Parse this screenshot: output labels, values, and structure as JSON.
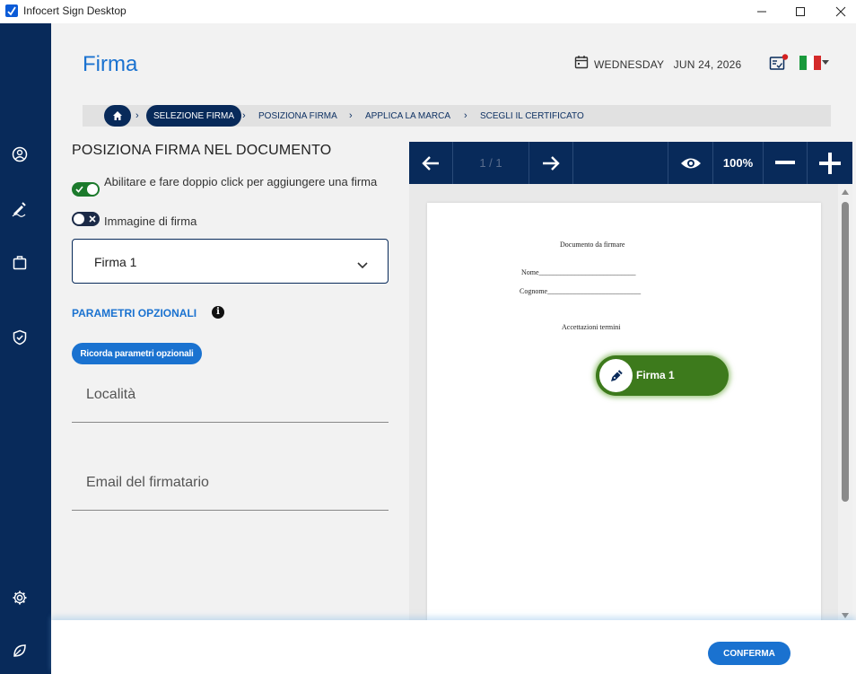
{
  "window": {
    "title": "Infocert Sign Desktop"
  },
  "header": {
    "title": "Firma",
    "date": "WEDNESDAY   JUN 24, 2026"
  },
  "breadcrumb": {
    "steps": [
      "SELEZIONE FIRMA",
      "POSIZIONA FIRMA",
      "APPLICA LA MARCA",
      "SCEGLI IL CERTIFICATO"
    ]
  },
  "form": {
    "section_title": "POSIZIONA FIRMA NEL DOCUMENTO",
    "toggle_enable_label": "Abilitare e fare doppio click per aggiungere una firma",
    "toggle_enable_on": true,
    "toggle_image_label": "Immagine di firma",
    "toggle_image_on": false,
    "signature_select": "Firma 1",
    "optional_title": "PARAMETRI OPZIONALI",
    "remember_button": "Ricorda parametri opzionali",
    "location_placeholder": "Località",
    "email_placeholder": "Email del firmatario"
  },
  "viewer": {
    "page_indicator": "1 / 1",
    "zoom": "100%",
    "document": {
      "title": "Documento da firmare",
      "name_line": "Nome___________________________",
      "surname_line": "Cognome__________________________",
      "terms": "Accettazioni termini"
    },
    "signature_field": "Firma 1"
  },
  "footer": {
    "confirm": "CONFERMA"
  },
  "colors": {
    "accent": "#1a72d0",
    "navy": "#082a5a",
    "signature_green": "#3d7a1c"
  }
}
